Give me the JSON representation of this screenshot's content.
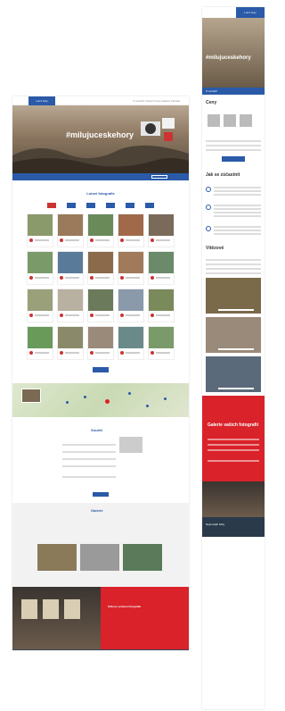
{
  "desktop": {
    "topbar_tag": "Luc’s hory",
    "nav": "O soutěži   Výherci   Ceny   Galerie   Kontakt",
    "hero_title": "#milujuceskehory",
    "section_title": "Lutovi fotografie",
    "prize_title": "Soutěž",
    "gallery_title": "Galerie",
    "exhib_title": "Odbory výstava fotografie"
  },
  "mobile": {
    "topbar_tag": "Luc’s hory",
    "hero_title": "#milujuceskehory",
    "bluebar": "O soutěži",
    "heading_prizes": "Ceny",
    "heading_how": "Jak se zúčastnit",
    "heading_winners": "Vítězové",
    "red_title": "Galerie vašich fotografií",
    "footer": "Nejnovější fotky"
  },
  "colors": {
    "brand_blue": "#2a5aa8",
    "accent_red": "#d9222a"
  }
}
